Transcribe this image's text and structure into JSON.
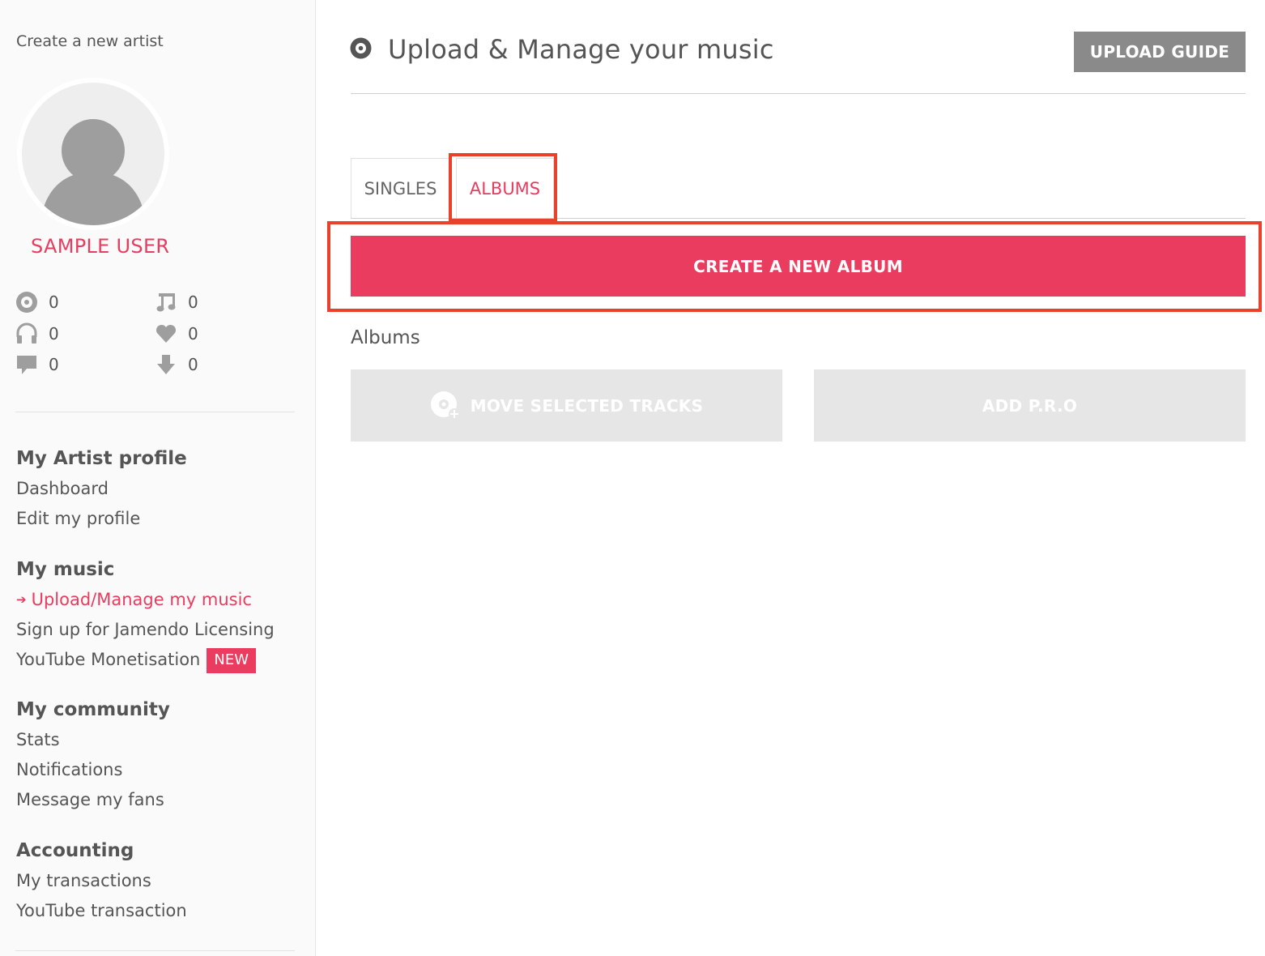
{
  "sidebar": {
    "create_artist": "Create a new artist",
    "user_name": "SAMPLE USER",
    "stats": [
      {
        "icon": "disc-icon",
        "value": "0"
      },
      {
        "icon": "music-note-icon",
        "value": "0"
      },
      {
        "icon": "headphones-icon",
        "value": "0"
      },
      {
        "icon": "heart-icon",
        "value": "0"
      },
      {
        "icon": "comment-icon",
        "value": "0"
      },
      {
        "icon": "download-icon",
        "value": "0"
      }
    ],
    "sections": [
      {
        "heading": "My Artist profile",
        "items": [
          "Dashboard",
          "Edit my profile"
        ]
      },
      {
        "heading": "My music",
        "items": [
          "Upload/Manage my music",
          "Sign up for Jamendo Licensing",
          "YouTube Monetisation"
        ]
      },
      {
        "heading": "My community",
        "items": [
          "Stats",
          "Notifications",
          "Message my fans"
        ]
      },
      {
        "heading": "Accounting",
        "items": [
          "My transactions",
          "YouTube transaction"
        ]
      }
    ],
    "new_badge": "NEW"
  },
  "main": {
    "title": "Upload & Manage your music",
    "upload_guide": "UPLOAD GUIDE",
    "tabs": [
      {
        "label": "SINGLES",
        "active": false
      },
      {
        "label": "ALBUMS",
        "active": true
      }
    ],
    "create_album": "CREATE A NEW ALBUM",
    "albums_label": "Albums",
    "move_tracks": "MOVE SELECTED TRACKS",
    "add_pro": "ADD P.R.O"
  },
  "colors": {
    "accent": "#e93c5e",
    "highlight": "#e8412c",
    "text": "#555555",
    "guide_button": "#8a8a8a",
    "disabled": "#e6e6e6"
  }
}
